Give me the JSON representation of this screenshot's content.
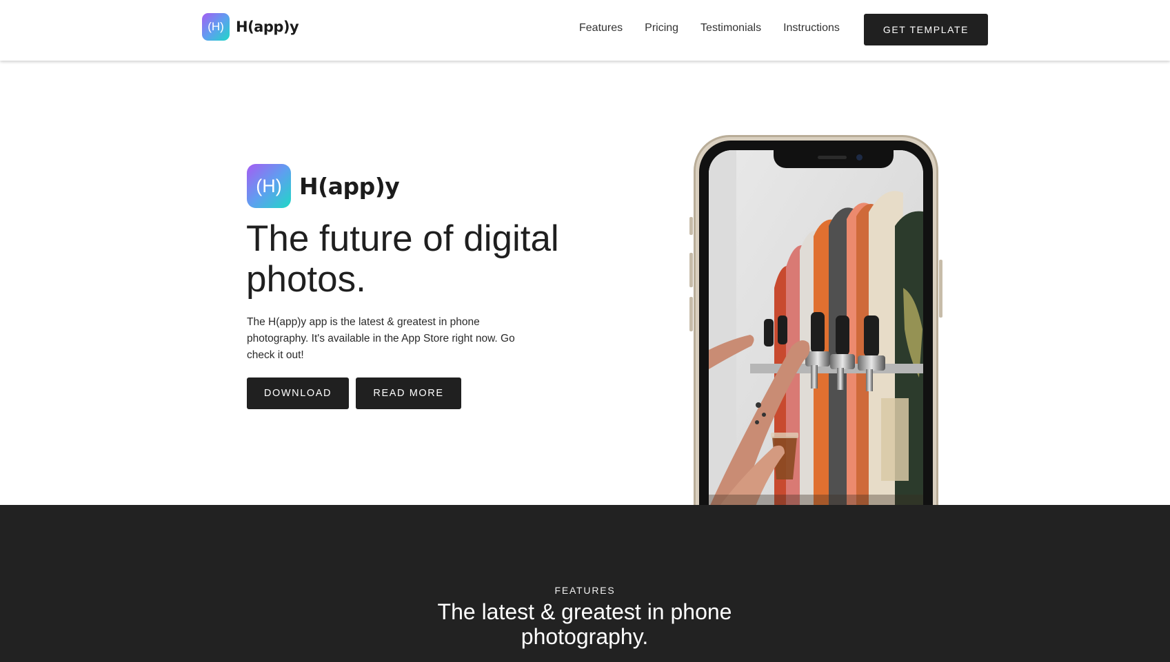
{
  "nav": {
    "brand": "H(app)y",
    "brand_icon_letter": "(H)",
    "links": [
      "Features",
      "Pricing",
      "Testimonials",
      "Instructions"
    ],
    "cta_label": "GET TEMPLATE"
  },
  "hero": {
    "brand": "H(app)y",
    "brand_icon_letter": "(H)",
    "title": "The future of digital photos.",
    "description": "The H(app)y app is the latest & greatest in phone photography. It's available in the App Store right now. Go check it out!",
    "download_label": "DOWNLOAD",
    "readmore_label": "READ MORE"
  },
  "features": {
    "eyebrow": "FEATURES",
    "title": "The latest & greatest in phone photography."
  },
  "colors": {
    "dark": "#202020",
    "features_bg": "#222222",
    "icon_gradient": [
      "#a55df2",
      "#1fd8c6"
    ],
    "phone_frame": "#d9cfbf"
  }
}
